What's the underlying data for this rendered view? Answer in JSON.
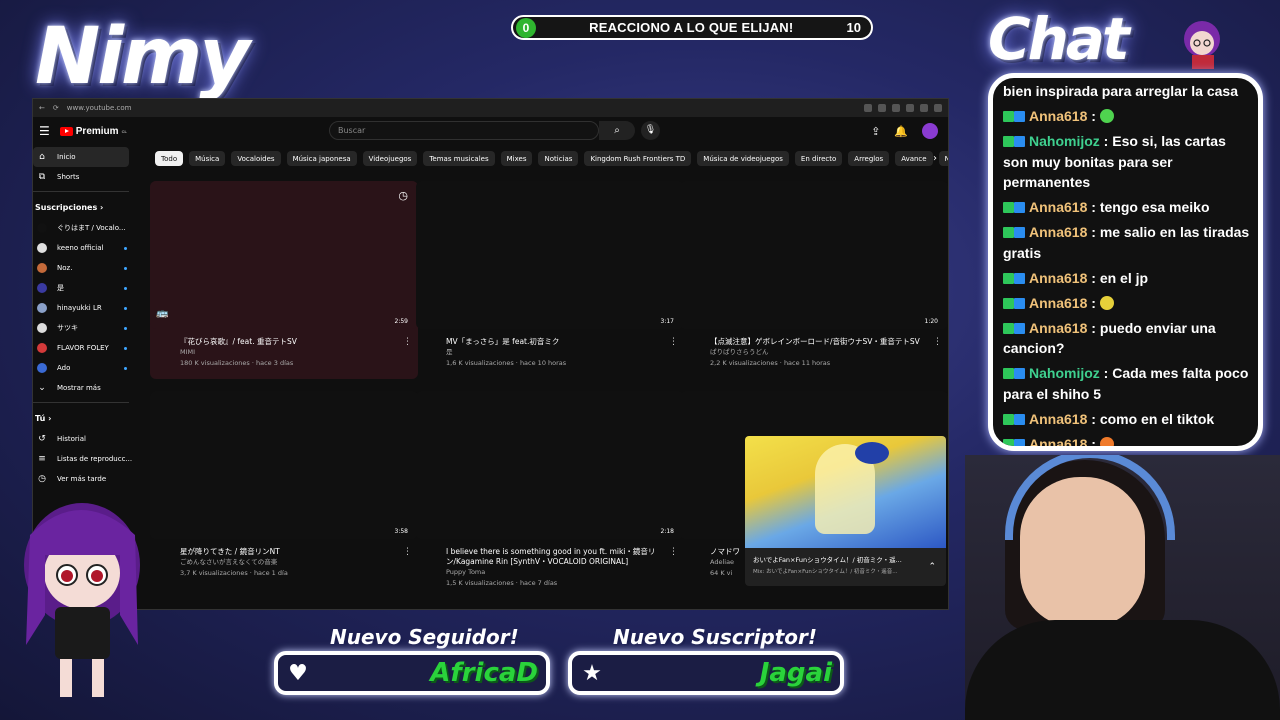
{
  "counter": {
    "left": "0",
    "title": "REACCIONO A LO QUE ELIJAN!",
    "right": "10"
  },
  "overlay": {
    "streamer_name": "Nimy",
    "chat_title": "Chat"
  },
  "browser": {
    "url": "www.youtube.com"
  },
  "youtube": {
    "logo_text": "Premium",
    "logo_badge": "CL",
    "search_placeholder": "Buscar",
    "sidebar": {
      "main": [
        {
          "label": "Inicio",
          "icon": "home-icon"
        },
        {
          "label": "Shorts",
          "icon": "shorts-icon"
        }
      ],
      "subs_heading": "Suscripciones",
      "subs": [
        {
          "label": "ぐりはまT / Vocalo...",
          "color": "#111111"
        },
        {
          "label": "keeno official",
          "color": "#e0e0e0"
        },
        {
          "label": "Noz.",
          "color": "#c46a3a"
        },
        {
          "label": "是",
          "color": "#3a3aa0"
        },
        {
          "label": "hinayukki LR",
          "color": "#8aa0c8"
        },
        {
          "label": "サツキ",
          "color": "#dddddd"
        },
        {
          "label": "FLAVOR FOLEY",
          "color": "#d43a3a"
        },
        {
          "label": "Ado",
          "color": "#3a6ad4"
        }
      ],
      "show_more": "Mostrar más",
      "you_heading": "Tú",
      "you": [
        {
          "label": "Historial",
          "icon": "history-icon"
        },
        {
          "label": "Listas de reproducc...",
          "icon": "playlist-icon"
        },
        {
          "label": "Ver más tarde",
          "icon": "watch-later-icon"
        }
      ]
    },
    "chips": [
      "Todo",
      "Música",
      "Vocaloides",
      "Música japonesa",
      "Videojuegos",
      "Temas musicales",
      "Mixes",
      "Noticias",
      "Kingdom Rush Frontiers TD",
      "Música de videojuegos",
      "En directo",
      "Arreglos",
      "Avance",
      "Nintendo"
    ],
    "videos": [
      {
        "title": "『花びら哀歌』/ feat. 重音テトSV",
        "channel": "MIMI",
        "meta": "180 K visualizaciones · hace 3 días",
        "duration": "2:59"
      },
      {
        "title": "MV「まっさら」是 feat.初音ミク",
        "channel": "是",
        "meta": "1,6 K visualizaciones · hace 10 horas",
        "duration": "3:17"
      },
      {
        "title": "【点滅注意】ゲボレインボーロード/音街ウナSV・重音テトSV",
        "channel": "ぱりぱりさらうどん",
        "meta": "2,2 K visualizaciones · hace 11 horas",
        "duration": "1:20"
      },
      {
        "title": "星が降りてきた / 鏡音リンNT",
        "channel": "ごめんなさいが言えなくての音楽",
        "meta": "3,7 K visualizaciones · hace 1 día",
        "duration": "3:58"
      },
      {
        "title": "I believe there is something good in you ft. miki・鏡音リン/Kagamine Rin [SynthV・VOCALOID ORIGINAL]",
        "channel": "Puppy Toma",
        "meta": "1,5 K visualizaciones · hace 7 días",
        "duration": "2:18"
      },
      {
        "title": "ノマドワ",
        "channel": "Adeliae",
        "meta": "64 K vi",
        "duration": ""
      }
    ],
    "miniplayer": {
      "title": "おいでよFan×Funショウタイム！/ 初音ミク・遥...",
      "subtitle": "Mix: おいでよFan×Funショウタイム！/ 初音ミク・遥音..."
    }
  },
  "chat": [
    {
      "user": "",
      "text": "bien inspirada para arreglar la casa",
      "color": "#ffffff",
      "badges": false
    },
    {
      "user": "Anna618",
      "text": "",
      "color": "#f0c27a",
      "badges": true,
      "emoji": "#4fd34f"
    },
    {
      "user": "Nahomijoz",
      "text": "Eso si, las cartas son muy bonitas para ser permanentes",
      "color": "#3fd08f",
      "badges": true
    },
    {
      "user": "Anna618",
      "text": "tengo esa meiko",
      "color": "#f0c27a",
      "badges": true
    },
    {
      "user": "Anna618",
      "text": "me salio en las tiradas gratis",
      "color": "#f0c27a",
      "badges": true
    },
    {
      "user": "Anna618",
      "text": "en el jp",
      "color": "#f0c27a",
      "badges": true
    },
    {
      "user": "Anna618",
      "text": "",
      "color": "#f0c27a",
      "badges": true,
      "emoji": "#e6d03a"
    },
    {
      "user": "Anna618",
      "text": "puedo enviar una cancion?",
      "color": "#f0c27a",
      "badges": true
    },
    {
      "user": "Nahomijoz",
      "text": "Cada mes falta poco para el shiho 5",
      "color": "#3fd08f",
      "badges": true
    },
    {
      "user": "Anna618",
      "text": "como en el tiktok",
      "color": "#f0c27a",
      "badges": true
    },
    {
      "user": "Anna618",
      "text": "",
      "color": "#f0c27a",
      "badges": true,
      "emoji": "#f07a2a"
    }
  ],
  "alerts": {
    "follower": {
      "title": "Nuevo Seguidor!",
      "name": "AfricaD"
    },
    "subscriber": {
      "title": "Nuevo Suscriptor!",
      "name": "Jagai"
    }
  }
}
